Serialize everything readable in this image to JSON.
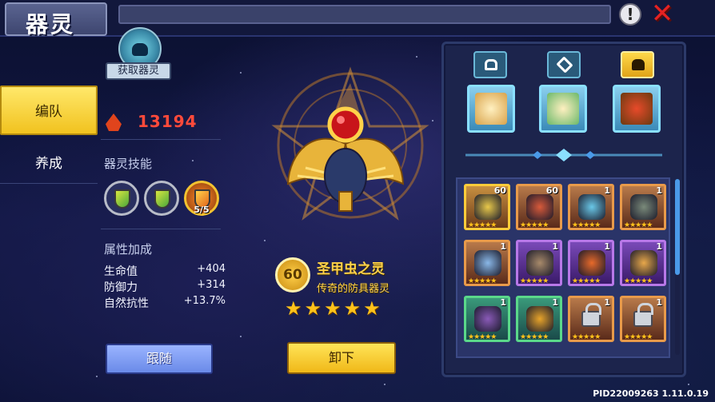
{
  "header": {
    "title": "器灵"
  },
  "sidebar": {
    "items": [
      {
        "label": "编队",
        "active": true
      },
      {
        "label": "养成",
        "active": false
      }
    ]
  },
  "left_panel": {
    "obtain_label": "获取器灵",
    "power_value": "13194",
    "skills_title": "器灵技能",
    "skills": [
      {
        "icon": "shield-skill-icon",
        "level": ""
      },
      {
        "icon": "shield-skill-icon",
        "level": ""
      },
      {
        "icon": "scarab-skill-icon",
        "level": "5/5"
      }
    ],
    "attributes_title": "属性加成",
    "attributes": [
      {
        "name": "生命值",
        "value": "+404"
      },
      {
        "name": "防御力",
        "value": "+314"
      },
      {
        "name": "自然抗性",
        "value": "+13.7%"
      }
    ],
    "follow_label": "跟随"
  },
  "spirit": {
    "level": "60",
    "name": "圣甲虫之灵",
    "type": "传奇的防具器灵",
    "stars": 5,
    "unequip_label": "卸下"
  },
  "right_panel": {
    "tabs": [
      {
        "icon": "ring-icon",
        "active": false
      },
      {
        "icon": "sword-icon",
        "active": false
      },
      {
        "icon": "shield-icon",
        "active": true
      }
    ],
    "equipped": [
      "slot-1",
      "slot-2",
      "slot-3"
    ],
    "grid": [
      {
        "rarity": "gold",
        "level": "60",
        "locked": false,
        "color": "#e8c84a"
      },
      {
        "rarity": "orange",
        "level": "60",
        "locked": false,
        "color": "#d85a3a"
      },
      {
        "rarity": "orange",
        "level": "1",
        "locked": false,
        "color": "#6ac8e8"
      },
      {
        "rarity": "orange",
        "level": "1",
        "locked": false,
        "color": "#7a8a7a"
      },
      {
        "rarity": "orange",
        "level": "1",
        "locked": false,
        "color": "#8ab8e8"
      },
      {
        "rarity": "purple",
        "level": "1",
        "locked": false,
        "color": "#a88a6a"
      },
      {
        "rarity": "purple",
        "level": "1",
        "locked": false,
        "color": "#e86a2a"
      },
      {
        "rarity": "purple",
        "level": "1",
        "locked": false,
        "color": "#e8a84a"
      },
      {
        "rarity": "green",
        "level": "1",
        "locked": false,
        "color": "#8a5ab8"
      },
      {
        "rarity": "green",
        "level": "1",
        "locked": false,
        "color": "#e8a42a"
      },
      {
        "rarity": "orange",
        "level": "1",
        "locked": true,
        "color": ""
      },
      {
        "rarity": "orange",
        "level": "1",
        "locked": true,
        "color": ""
      }
    ]
  },
  "footer": {
    "build_id": "PID22009263 1.11.0.19"
  },
  "colors": {
    "accent_gold": "#ffd24a",
    "power_red": "#ff4a3a",
    "close_red": "#e52222"
  }
}
